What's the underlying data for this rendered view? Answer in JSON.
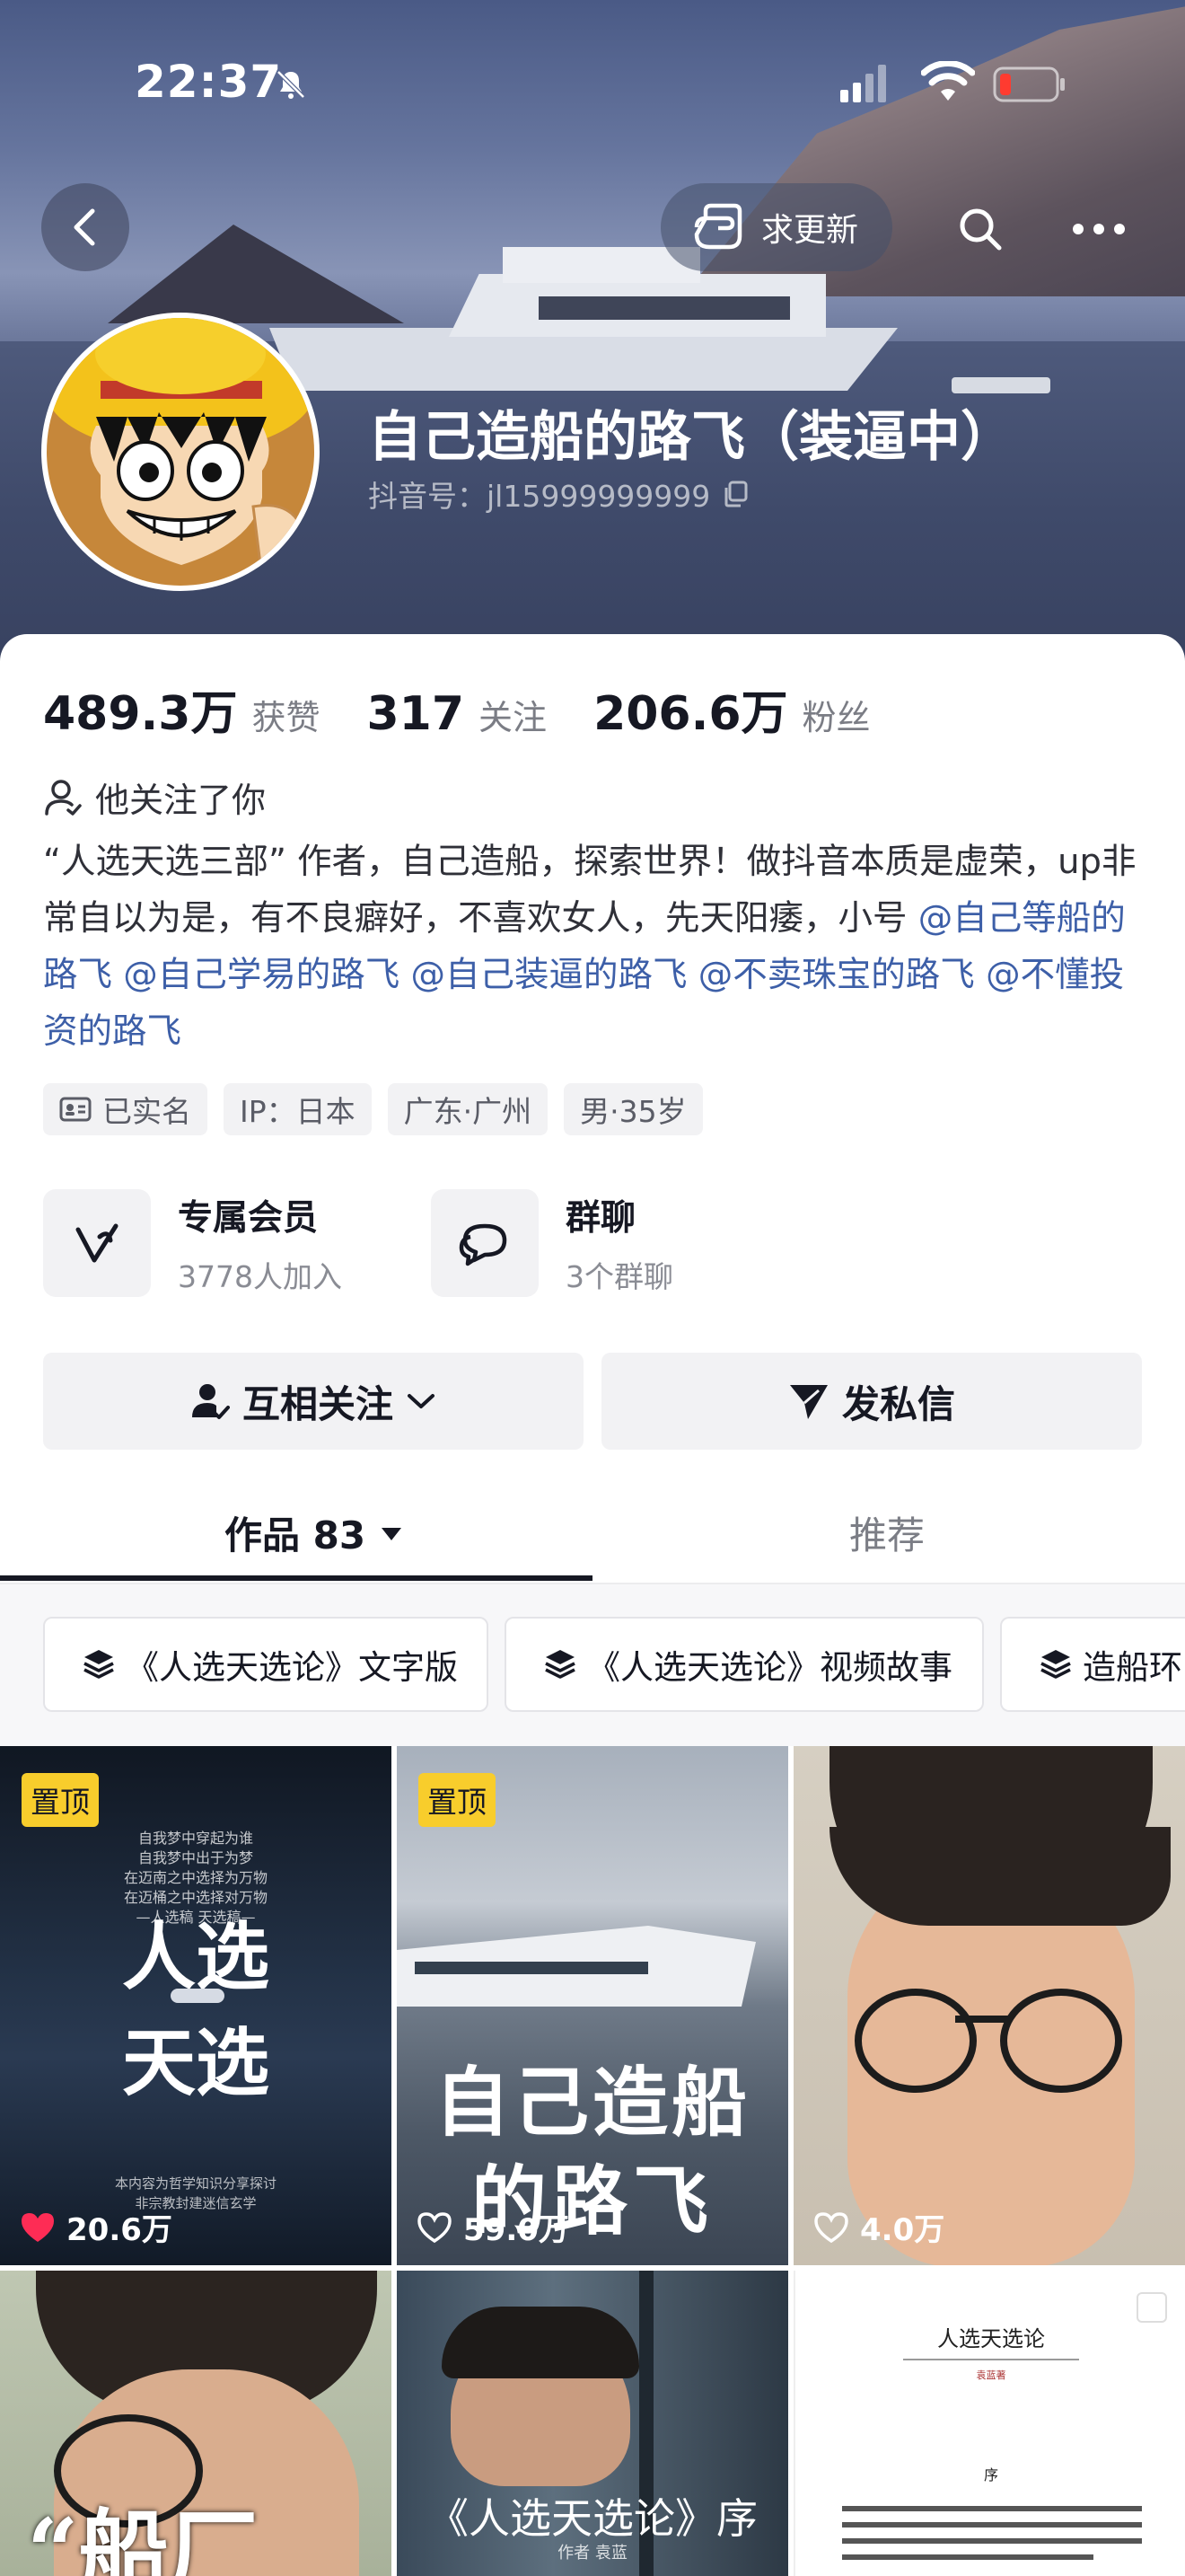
{
  "status_bar": {
    "time": "22:37"
  },
  "header": {
    "update_label": "求更新"
  },
  "profile": {
    "name": "自己造船的路飞（装逼中）",
    "douyin_id": "抖音号：jl15999999999",
    "stats": [
      {
        "num": "489.3万",
        "label": "获赞"
      },
      {
        "num": "317",
        "label": "关注"
      },
      {
        "num": "206.6万",
        "label": "粉丝"
      }
    ],
    "follows_you": "他关注了你",
    "bio_text": "“人选天选三部” 作者，自己造船，探索世界！做抖音本质是虚荣，up非常自以为是，有不良癖好，不喜欢女人，先天阳痿，小号",
    "bio_mentions": [
      "@自己等船的路飞",
      "@自己学易的路飞",
      "@自己装逼的路飞",
      "@不卖珠宝的路飞",
      "@不懂投资的路飞"
    ],
    "tags": [
      "已实名",
      "IP：日本",
      "广东·广州",
      "男·35岁"
    ]
  },
  "features": {
    "member": {
      "title": "专属会员",
      "sub": "3778人加入"
    },
    "group": {
      "title": "群聊",
      "sub": "3个群聊"
    }
  },
  "actions": {
    "follow": "互相关注",
    "message": "发私信"
  },
  "tabs": {
    "works": "作品 83",
    "recommend": "推荐"
  },
  "collections": [
    "《人选天选论》文字版",
    "《人选天选论》视频故事",
    "造船环"
  ],
  "videos": [
    {
      "pinned": "置顶",
      "likes": "20.6万",
      "caption_lines": [
        "人选",
        "天选"
      ],
      "header_lines": [
        "自我梦中穿起为谁",
        "自我梦中出于为梦",
        "在迈南之中选择为万物",
        "在迈桶之中选择对万物",
        "—人选稿 天选稿—"
      ],
      "footer_lines": [
        "本内容为哲学知识分享探讨",
        "非宗教封建迷信玄学"
      ],
      "liked": true
    },
    {
      "pinned": "置顶",
      "likes": "59.0万",
      "caption_lines": [
        "自己造船",
        "的路飞"
      ],
      "liked": false
    },
    {
      "likes": "4.0万",
      "liked": false
    },
    {
      "caption_lines": [
        "“船厂"
      ]
    },
    {
      "caption_lines": [
        "《人选天选论》序"
      ],
      "sub": "作者  袁蓝"
    },
    {
      "doc_title": "人选天选论",
      "doc_author": "袁蓝著",
      "doc_section": "序"
    }
  ],
  "colors": {
    "accent_yellow": "#f8cd2c",
    "mention_blue": "#3d5fa8",
    "like_red": "#fe2c55"
  }
}
